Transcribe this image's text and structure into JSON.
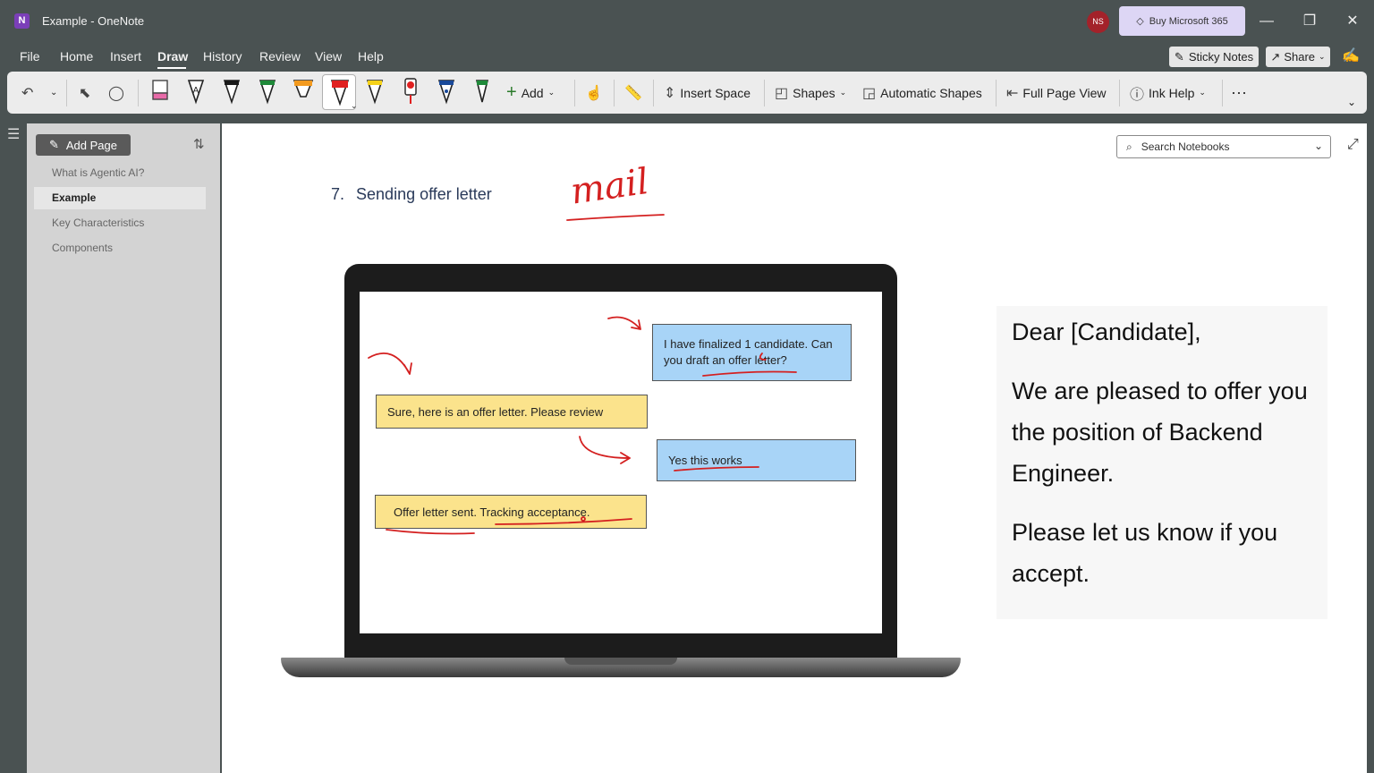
{
  "window": {
    "app_icon": "N",
    "title": "Example  -  OneNote",
    "avatar_initials": "NS",
    "buy_label": "Buy Microsoft 365",
    "controls": {
      "minimize": "—",
      "maximize": "❐",
      "close": "✕"
    }
  },
  "menu": {
    "items": [
      "File",
      "Home",
      "Insert",
      "Draw",
      "History",
      "Review",
      "View",
      "Help"
    ],
    "active": "Draw",
    "sticky_notes": "Sticky Notes",
    "share": "Share"
  },
  "ribbon": {
    "add_label": "Add",
    "insert_space": "Insert Space",
    "shapes": "Shapes",
    "automatic_shapes": "Automatic Shapes",
    "full_page_view": "Full Page View",
    "ink_help": "Ink Help",
    "more": "···",
    "pens": [
      {
        "name": "highlighter-pink",
        "color": "#e86aa8"
      },
      {
        "name": "pen-black-outline",
        "color": "#ffffff"
      },
      {
        "name": "pen-black",
        "color": "#1a1a1a"
      },
      {
        "name": "pen-green",
        "color": "#1f8a3a"
      },
      {
        "name": "highlighter-orange",
        "color": "#f39a1e"
      },
      {
        "name": "pen-red",
        "color": "#e02020"
      },
      {
        "name": "highlighter-yellow",
        "color": "#f5d21a"
      },
      {
        "name": "marker-red",
        "color": "#e02020"
      },
      {
        "name": "fountain-pen-blue",
        "color": "#1a4a9a"
      },
      {
        "name": "pen-green-2",
        "color": "#1f8a3a"
      }
    ]
  },
  "sidebar": {
    "add_page": "Add Page",
    "pages": [
      "What is Agentic AI?",
      "Example",
      "Key Characteristics",
      "Components"
    ],
    "active_page": "Example"
  },
  "canvas": {
    "search_placeholder": "Search Notebooks",
    "heading_number": "7.",
    "heading_text": "Sending offer letter",
    "ink_text": "mail",
    "chat": [
      {
        "id": "user1",
        "text": "I have finalized 1 candidate. Can you draft an offer letter?",
        "color": "#a8d4f7"
      },
      {
        "id": "agent1",
        "text": "Sure, here is an offer letter. Please review",
        "color": "#fbe38c"
      },
      {
        "id": "user2",
        "text": "Yes this works",
        "color": "#a8d4f7"
      },
      {
        "id": "agent2",
        "text": "Offer letter sent. Tracking acceptance.",
        "color": "#fbe38c"
      }
    ],
    "letter": {
      "greeting": "Dear [Candidate],",
      "body1": "We are pleased to offer you the position of Backend Engineer.",
      "body2": "Please let us know if you accept."
    },
    "ink_color": "#d42020"
  }
}
